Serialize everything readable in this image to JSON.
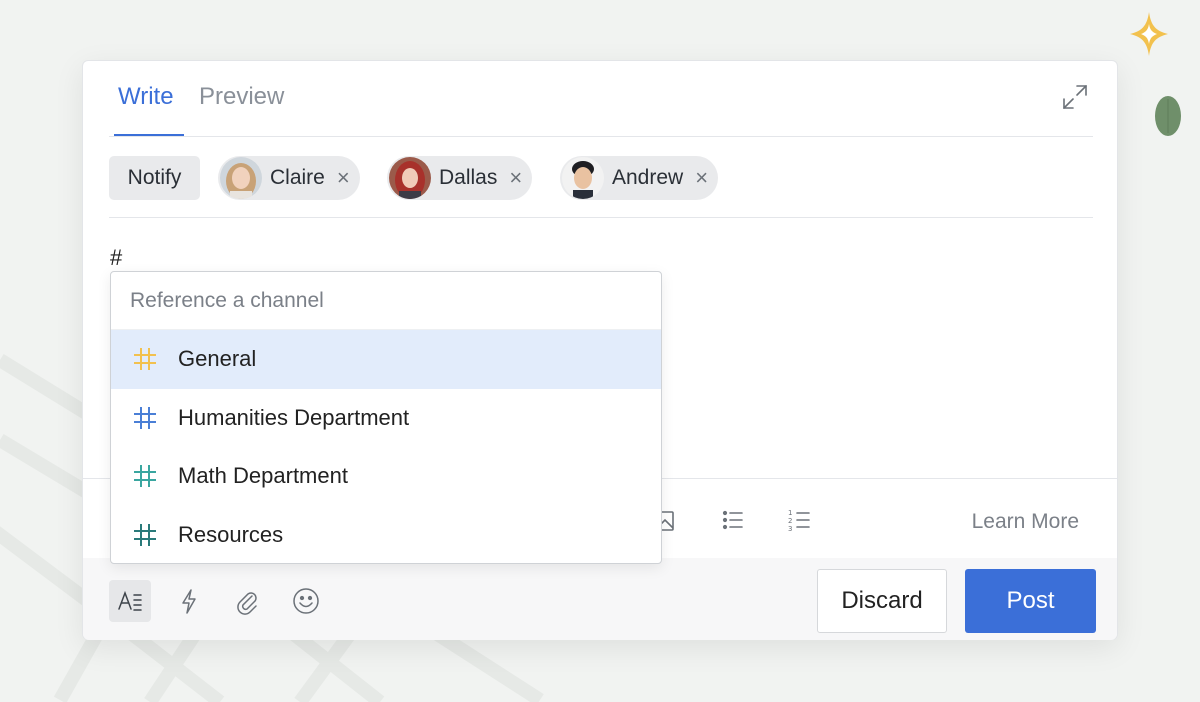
{
  "tabs": {
    "write": "Write",
    "preview": "Preview",
    "active": "Write"
  },
  "notify": {
    "button_label": "Notify",
    "recipients": [
      {
        "name": "Claire",
        "remove": "×"
      },
      {
        "name": "Dallas",
        "remove": "×"
      },
      {
        "name": "Andrew",
        "remove": "×"
      }
    ]
  },
  "editor": {
    "content": "#"
  },
  "channel_menu": {
    "placeholder": "Reference a channel",
    "items": [
      {
        "label": "General",
        "color": "#f2c14e",
        "selected": true
      },
      {
        "label": "Humanities Department",
        "color": "#4a7fd6",
        "selected": false
      },
      {
        "label": "Math Department",
        "color": "#3aa6a0",
        "selected": false
      },
      {
        "label": "Resources",
        "color": "#2a7a7a",
        "selected": false
      }
    ]
  },
  "toolbar": {
    "learn_more": "Learn More"
  },
  "footer": {
    "discard_label": "Discard",
    "post_label": "Post"
  },
  "colors": {
    "accent": "#3b6fd8",
    "sparkle": "#f2c14e",
    "leaf": "#6f8f6a"
  }
}
